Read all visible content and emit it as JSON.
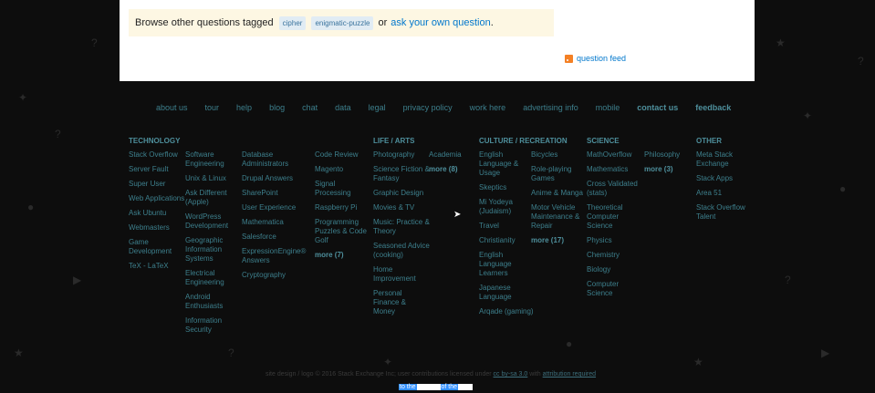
{
  "question_footer": {
    "prefix": "Browse other questions tagged",
    "tags": [
      "cipher",
      "enigmatic-puzzle"
    ],
    "or": "or",
    "ask_link": "ask your own question",
    "suffix": "."
  },
  "feed_label": "question feed",
  "footer_links": [
    {
      "label": "about us",
      "strong": false
    },
    {
      "label": "tour",
      "strong": false
    },
    {
      "label": "help",
      "strong": false
    },
    {
      "label": "blog",
      "strong": false
    },
    {
      "label": "chat",
      "strong": false
    },
    {
      "label": "data",
      "strong": false
    },
    {
      "label": "legal",
      "strong": false
    },
    {
      "label": "privacy policy",
      "strong": false
    },
    {
      "label": "work here",
      "strong": false
    },
    {
      "label": "advertising info",
      "strong": false
    },
    {
      "label": "mobile",
      "strong": false
    },
    {
      "label": "contact us",
      "strong": true
    },
    {
      "label": "feedback",
      "strong": true
    }
  ],
  "columns": [
    {
      "heading": "TECHNOLOGY",
      "items": [
        "Stack Overflow",
        "Server Fault",
        "Super User",
        "Web Applications",
        "Ask Ubuntu",
        "Webmasters",
        "Game Development",
        "TeX - LaTeX"
      ],
      "more": ""
    },
    {
      "heading": "",
      "items": [
        "Software Engineering",
        "Unix & Linux",
        "Ask Different (Apple)",
        "WordPress Development",
        "Geographic Information Systems",
        "Electrical Engineering",
        "Android Enthusiasts",
        "Information Security"
      ],
      "more": ""
    },
    {
      "heading": "",
      "items": [
        "Database Administrators",
        "Drupal Answers",
        "SharePoint",
        "User Experience",
        "Mathematica",
        "Salesforce",
        "ExpressionEngine® Answers",
        "Cryptography"
      ],
      "more": ""
    },
    {
      "heading": "",
      "items": [
        "Code Review",
        "Magento",
        "Signal Processing",
        "Raspberry Pi",
        "Programming Puzzles & Code Golf"
      ],
      "more": "more (7)"
    },
    {
      "heading": "LIFE / ARTS",
      "items": [
        "Photography",
        "Science Fiction & Fantasy",
        "Graphic Design",
        "Movies & TV",
        "Music: Practice & Theory",
        "Seasoned Advice (cooking)",
        "Home Improvement",
        "Personal Finance & Money"
      ],
      "more": ""
    },
    {
      "heading": "",
      "items": [
        "Academia"
      ],
      "more": "more (8)"
    },
    {
      "heading": "CULTURE / RECREATION",
      "items": [
        "English Language & Usage",
        "Skeptics",
        "Mi Yodeya (Judaism)",
        "Travel",
        "Christianity",
        "English Language Learners",
        "Japanese Language",
        "Arqade (gaming)"
      ],
      "more": ""
    },
    {
      "heading": "",
      "items": [
        "Bicycles",
        "Role-playing Games",
        "Anime & Manga",
        "Motor Vehicle Maintenance & Repair"
      ],
      "more": "more (17)"
    },
    {
      "heading": "SCIENCE",
      "items": [
        "MathOverflow",
        "Mathematics",
        "Cross Validated (stats)",
        "Theoretical Computer Science",
        "Physics",
        "Chemistry",
        "Biology",
        "Computer Science"
      ],
      "more": ""
    },
    {
      "heading": "",
      "items": [
        "Philosophy"
      ],
      "more": "more (3)"
    },
    {
      "heading": "OTHER",
      "items": [
        "Meta Stack Exchange",
        "Stack Apps",
        "Area 51",
        "Stack Overflow Talent"
      ],
      "more": ""
    }
  ],
  "legal": {
    "text": "site design / logo © 2016 Stack Exchange Inc; user contributions licensed under",
    "license_link": "cc by-sa 3.0",
    "with": "with",
    "attribution_link": "attribution required"
  },
  "selection_text": {
    "part1": "to the",
    "part2": "of the"
  }
}
